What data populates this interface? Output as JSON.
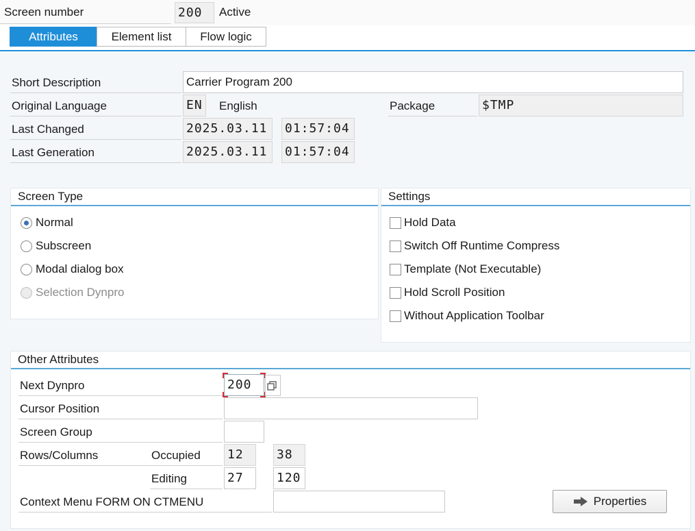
{
  "header": {
    "screen_number_label": "Screen number",
    "screen_number_value": "200",
    "status": "Active"
  },
  "tabs": [
    {
      "label": "Attributes",
      "active": true
    },
    {
      "label": "Element list",
      "active": false
    },
    {
      "label": "Flow logic",
      "active": false
    }
  ],
  "attributes": {
    "short_description_label": "Short Description",
    "short_description_value": "Carrier Program 200",
    "original_language_label": "Original Language",
    "language_code": "EN",
    "language_name": "English",
    "package_label": "Package",
    "package_value": "$TMP",
    "last_changed_label": "Last Changed",
    "last_changed_date": "2025.03.11",
    "last_changed_time": "01:57:04",
    "last_generation_label": "Last Generation",
    "last_generation_date": "2025.03.11",
    "last_generation_time": "01:57:04"
  },
  "screen_type": {
    "title": "Screen Type",
    "options": [
      {
        "label": "Normal",
        "selected": true,
        "enabled": true
      },
      {
        "label": "Subscreen",
        "selected": false,
        "enabled": true
      },
      {
        "label": "Modal dialog box",
        "selected": false,
        "enabled": true
      },
      {
        "label": "Selection Dynpro",
        "selected": false,
        "enabled": false
      }
    ]
  },
  "settings": {
    "title": "Settings",
    "options": [
      {
        "label": "Hold Data",
        "checked": false
      },
      {
        "label": "Switch Off Runtime Compress",
        "checked": false
      },
      {
        "label": "Template (Not Executable)",
        "checked": false
      },
      {
        "label": "Hold Scroll Position",
        "checked": false
      },
      {
        "label": "Without Application Toolbar",
        "checked": false
      }
    ]
  },
  "other": {
    "title": "Other Attributes",
    "next_dynpro_label": "Next Dynpro",
    "next_dynpro_value": "200",
    "cursor_position_label": "Cursor Position",
    "cursor_position_value": "",
    "screen_group_label": "Screen Group",
    "screen_group_value": "",
    "rows_columns_label": "Rows/Columns",
    "occupied_label": "Occupied",
    "occupied_rows": "12",
    "occupied_cols": "38",
    "editing_label": "Editing",
    "editing_rows": "27",
    "editing_cols": "120",
    "context_menu_label": "Context Menu FORM ON CTMENU",
    "context_menu_value": "",
    "properties_button": "Properties"
  },
  "colors": {
    "accent": "#1f8ed9",
    "panel_rule": "#5aa7d6",
    "focus_marker": "#d0303c"
  }
}
